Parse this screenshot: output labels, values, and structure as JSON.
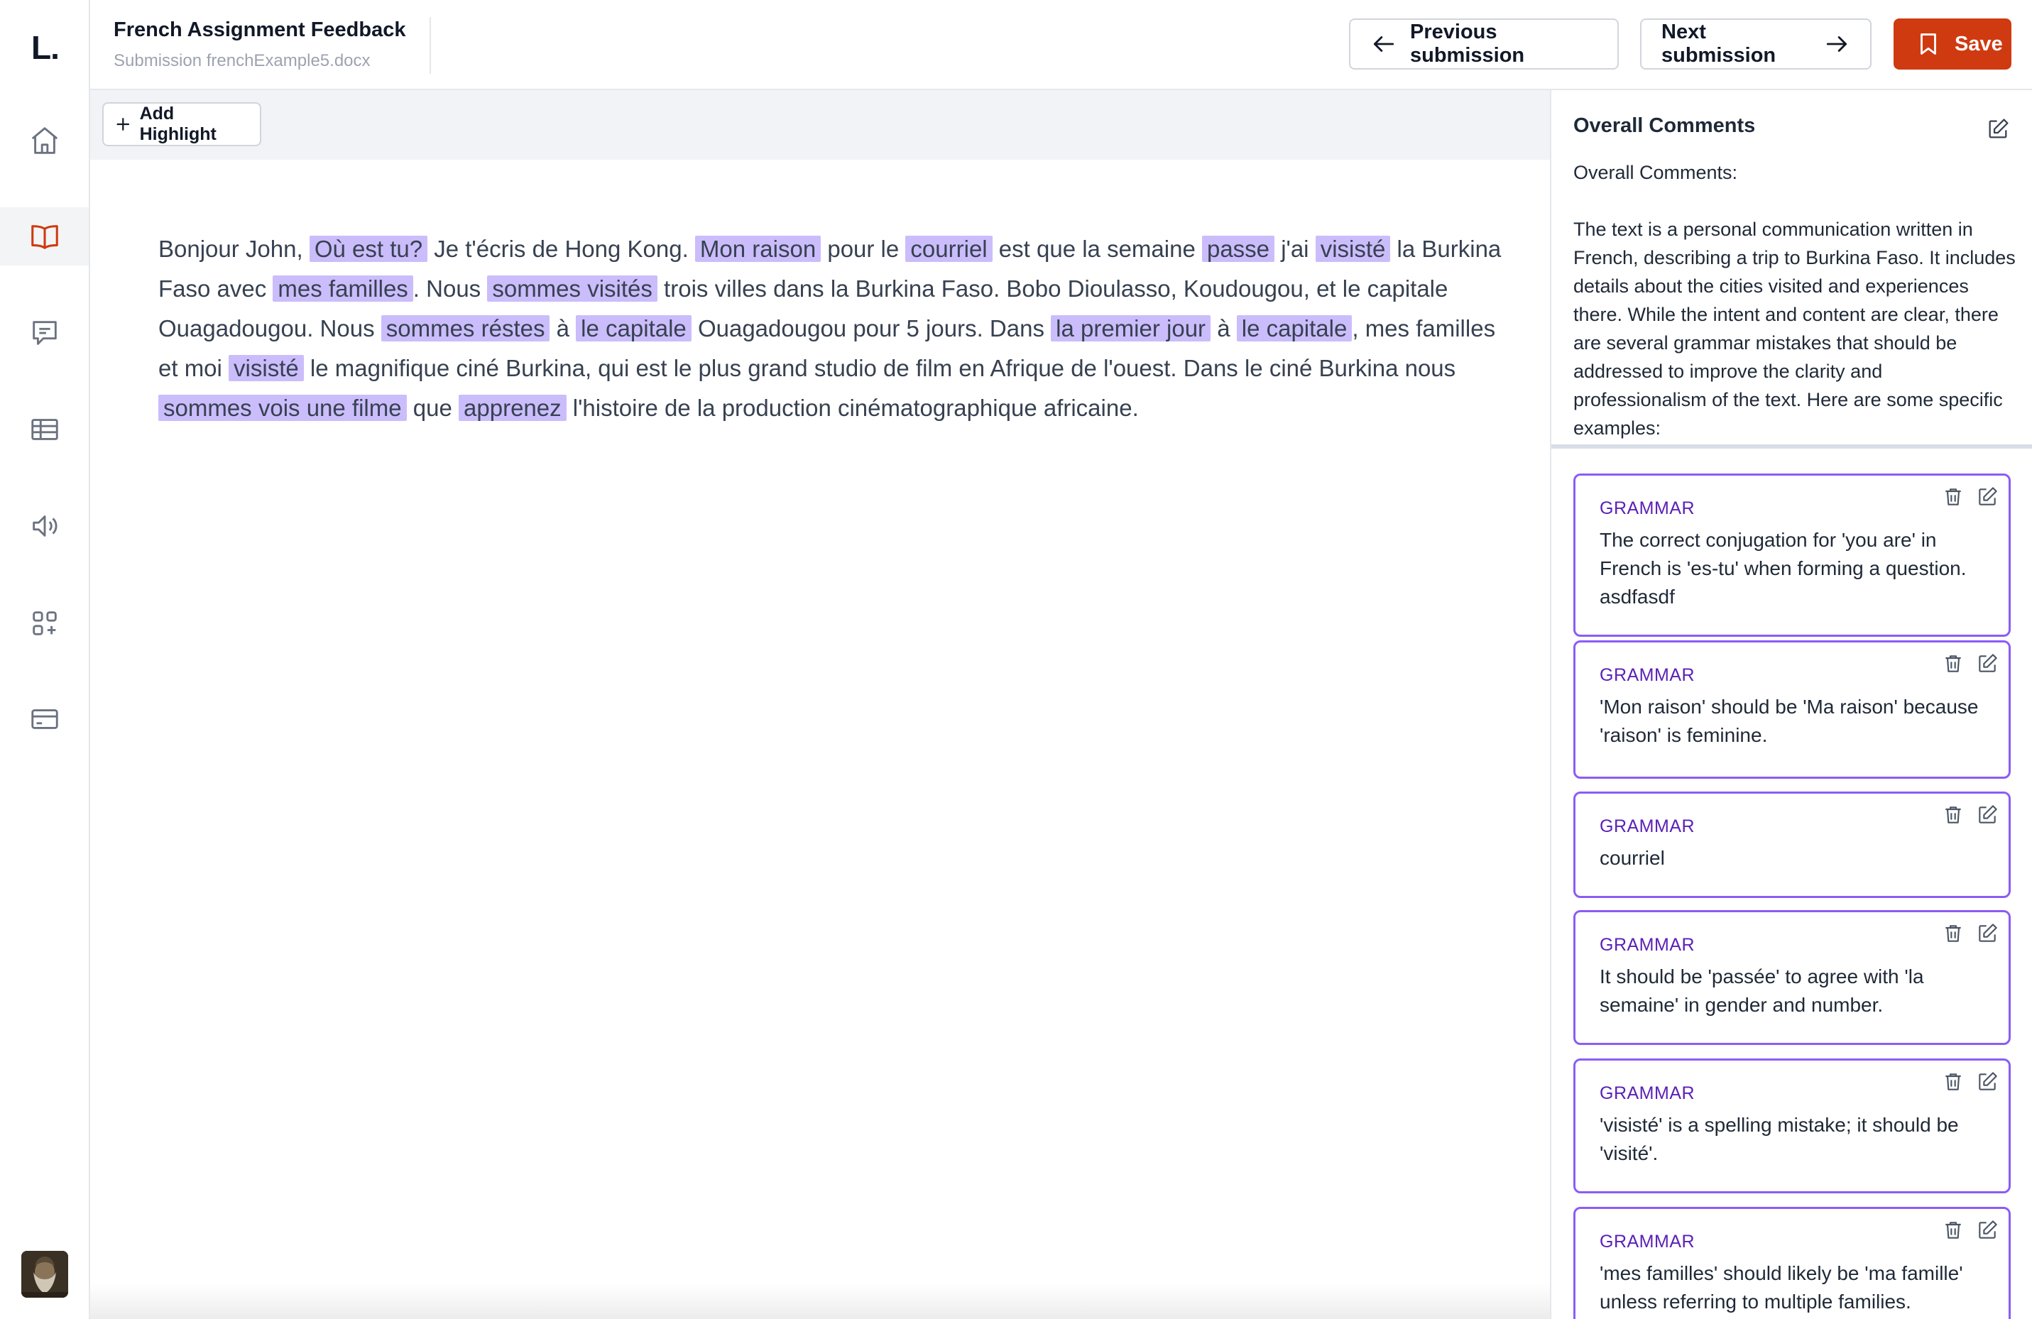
{
  "app": {
    "logo": "L."
  },
  "header": {
    "title": "French Assignment Feedback",
    "subtitle": "Submission frenchExample5.docx",
    "prev_label": "Previous submission",
    "next_label": "Next submission",
    "save_label": "Save"
  },
  "colors": {
    "accent": "#cf3a10",
    "highlight": "#cbbdfb",
    "card_border": "#8b5cf6",
    "category": "#5b21b6"
  },
  "sidebar": {
    "items": [
      {
        "icon": "home-icon"
      },
      {
        "icon": "book-icon",
        "active": true
      },
      {
        "icon": "chat-icon"
      },
      {
        "icon": "table-icon"
      },
      {
        "icon": "speaker-icon"
      },
      {
        "icon": "apps-icon"
      },
      {
        "icon": "card-icon"
      }
    ]
  },
  "toolbar": {
    "add_highlight_label": "Add Highlight"
  },
  "document": {
    "segments": [
      {
        "text": "Bonjour John, "
      },
      {
        "text": "Où est tu?",
        "highlight": true
      },
      {
        "text": " Je t'écris de Hong Kong. "
      },
      {
        "text": "Mon raison",
        "highlight": true
      },
      {
        "text": " pour le "
      },
      {
        "text": "courriel",
        "highlight": true
      },
      {
        "text": " est que la semaine "
      },
      {
        "text": "passe",
        "highlight": true
      },
      {
        "text": " j'ai "
      },
      {
        "text": "visisté",
        "highlight": true
      },
      {
        "text": " la Burkina Faso avec "
      },
      {
        "text": "mes familles",
        "highlight": true
      },
      {
        "text": ". Nous "
      },
      {
        "text": "sommes visités",
        "highlight": true
      },
      {
        "text": " trois villes dans la Burkina Faso. Bobo Dioulasso, Koudougou, et le capitale Ouagadougou. Nous "
      },
      {
        "text": "sommes réstes",
        "highlight": true
      },
      {
        "text": " à "
      },
      {
        "text": "le capitale",
        "highlight": true
      },
      {
        "text": " Ouagadougou pour 5 jours. Dans "
      },
      {
        "text": "la premier jour",
        "highlight": true
      },
      {
        "text": " à "
      },
      {
        "text": "le capitale",
        "highlight": true
      },
      {
        "text": ", mes familles et moi "
      },
      {
        "text": "visisté",
        "highlight": true
      },
      {
        "text": " le magnifique ciné Burkina, qui est le plus grand studio de film en Afrique de l'ouest. Dans le ciné Burkina nous "
      },
      {
        "text": "sommes vois une filme",
        "highlight": true
      },
      {
        "text": " que "
      },
      {
        "text": "apprenez",
        "highlight": true
      },
      {
        "text": " l'histoire de la production cinématographique africaine."
      }
    ]
  },
  "panel": {
    "heading": "Overall Comments",
    "overall_text": "Overall Comments:\n\nThe text is a personal communication written in French, describing a trip to Burkina Faso. It includes details about the cities visited and experiences there. While the intent and content are clear, there are several grammar mistakes that should be addressed to improve the clarity and professionalism of the text. Here are some specific examples:",
    "comments": [
      {
        "category": "GRAMMAR",
        "text": "The correct conjugation for 'you are' in French is 'es-tu' when forming a question. asdfasdf"
      },
      {
        "category": "GRAMMAR",
        "text": "'Mon raison' should be 'Ma raison' because 'raison' is feminine."
      },
      {
        "category": "GRAMMAR",
        "text": "courriel"
      },
      {
        "category": "GRAMMAR",
        "text": "It should be 'passée' to agree with 'la semaine' in gender and number."
      },
      {
        "category": "GRAMMAR",
        "text": "'visisté' is a spelling mistake; it should be 'visité'."
      },
      {
        "category": "GRAMMAR",
        "text": "'mes familles' should likely be 'ma famille' unless referring to multiple families."
      }
    ]
  }
}
